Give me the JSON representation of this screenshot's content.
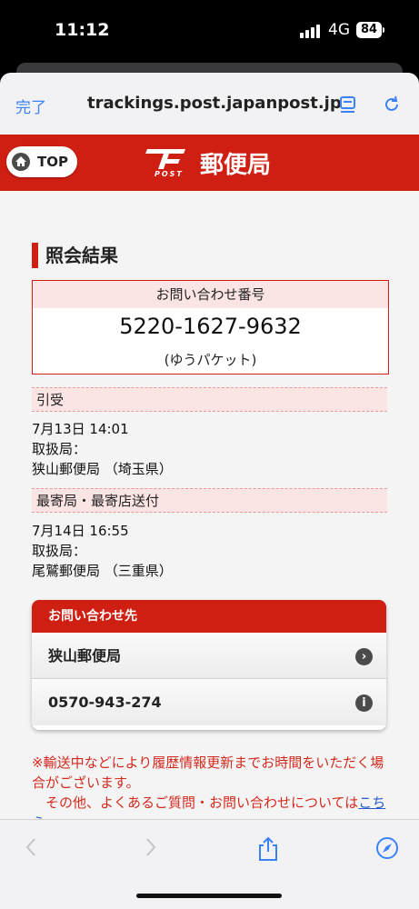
{
  "status_bar": {
    "time": "11:12",
    "network": "4G",
    "battery": "84"
  },
  "browser": {
    "done_label": "完了",
    "url": "trackings.post.japanpost.jp"
  },
  "header": {
    "top_button": "TOP",
    "logo_text": "POST",
    "brand": "郵便局"
  },
  "result": {
    "section_title": "照会結果",
    "tracking_label": "お問い合わせ番号",
    "tracking_number": "5220-1627-9632",
    "service_type": "(ゆうパケット)"
  },
  "events": [
    {
      "status": "引受",
      "datetime": "7月13日 14:01",
      "office_label": "取扱局：",
      "office": "狭山郵便局 （埼玉県）"
    },
    {
      "status": "最寄局・最寄店送付",
      "datetime": "7月14日 16:55",
      "office_label": "取扱局：",
      "office": "尾鷲郵便局 （三重県）"
    }
  ],
  "contact": {
    "header": "お問い合わせ先",
    "office": "狭山郵便局",
    "phone": "0570-943-274"
  },
  "notice": {
    "line1": "※輸送中などにより履歴情報更新までお時間をいただく場合がございます。",
    "line2": "その他、よくあるご質問・お問い合わせについては",
    "link": "こちら"
  },
  "colors": {
    "jp_red": "#cf1e12",
    "safari_blue": "#3b82f6",
    "notice_red": "#d42a1e"
  }
}
